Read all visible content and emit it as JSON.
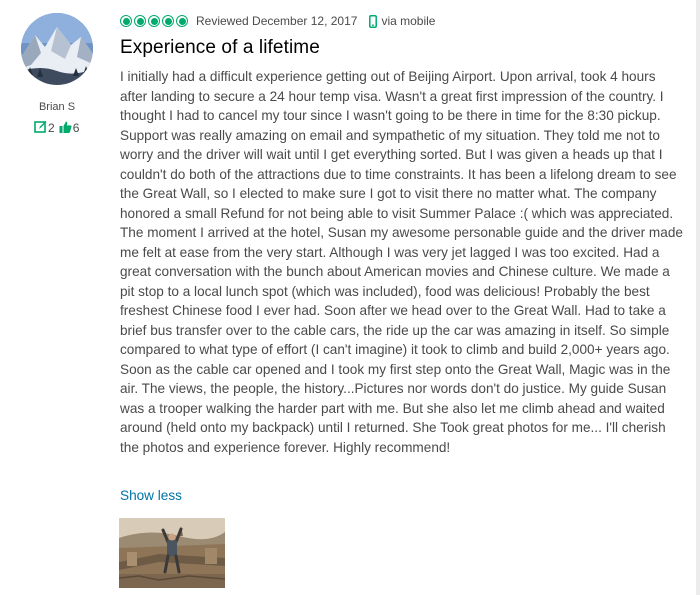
{
  "reviewer": {
    "name": "Brian S",
    "reviews_count": "2",
    "helpful_votes": "6"
  },
  "review": {
    "rating": 5,
    "rating_max": 5,
    "date": "Reviewed December 12, 2017",
    "source": "via mobile",
    "title": "Experience of a lifetime",
    "body": "I initially had a difficult experience getting out of Beijing Airport. Upon arrival, took 4 hours after landing to secure a 24 hour temp visa. Wasn't a great first impression of the country. I thought I had to cancel my tour since I wasn't going to be there in time for the 8:30 pickup. Support was really amazing on email and sympathetic of my situation. They told me not to worry and the driver will wait until I get everything sorted. But I was given a heads up that I couldn't do both of the attractions due to time constraints. It has been a lifelong dream to see the Great Wall, so I elected to make sure I got to visit there no matter what. The company honored a small Refund for not being able to visit Summer Palace :( which was appreciated. The moment I arrived at the hotel, Susan my awesome personable guide and the driver made me felt at ease from the very start. Although I was very jet lagged I was too excited. Had a great conversation with the bunch about American movies and Chinese culture. We made a pit stop to a local lunch spot (which was included), food was delicious! Probably the best freshest Chinese food I ever had. Soon after we head over to the Great Wall. Had to take a brief bus transfer over to the cable cars, the ride up the car was amazing in itself. So simple compared to what type of effort (I can't imagine) it took to climb and build 2,000+ years ago. Soon as the cable car opened and I took my first step onto the Great Wall, Magic was in the air. The views, the people, the history...Pictures nor words don't do justice. My guide Susan was a trooper walking the harder part with me. But she also let me climb ahead and waited around (held onto my backpack) until I returned. She Took great photos for me... I'll cherish the photos and experience forever. Highly recommend!",
    "show_less_label": "Show less"
  },
  "colors": {
    "accent_green": "#00aa6c",
    "link_blue": "#0073a7",
    "text": "#4a4a4a",
    "title": "#000000"
  },
  "icons": {
    "rating": "bubble-rating-icon",
    "mobile": "mobile-phone-icon",
    "reviews": "review-count-icon",
    "helpful": "thumbs-up-icon"
  }
}
